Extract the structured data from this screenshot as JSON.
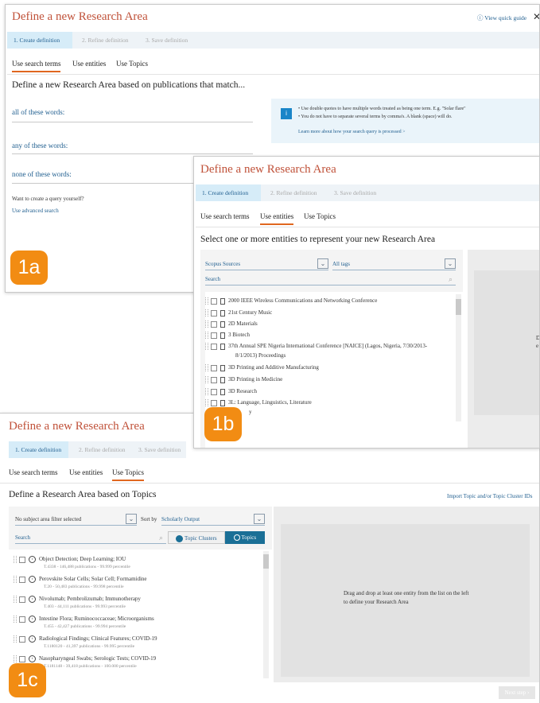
{
  "panel_a": {
    "title": "Define a new Research Area",
    "quick_guide": "View quick guide",
    "steps": [
      "1. Create definition",
      "2. Refine definition",
      "3. Save definition"
    ],
    "tabs": [
      "Use search terms",
      "Use entities",
      "Use Topics"
    ],
    "heading": "Define a new Research Area based on publications that match...",
    "fields": [
      "all of these words:",
      "any of these words:",
      "none of these words:"
    ],
    "info_lines": [
      "Use double quotes to have multiple words treated as being one term. E.g. \"Solar flare\"",
      "You do not have to separate several terms by comma's. A blank (space) will do."
    ],
    "info_link": "Learn more about how your search query is processed >",
    "query_prompt": "Want to create a query yourself?",
    "advanced_link": "Use advanced search",
    "badge": "1a"
  },
  "panel_b": {
    "title": "Define a new Research Area",
    "steps": [
      "1. Create definition",
      "2. Refine definition",
      "3. Save definition"
    ],
    "tabs": [
      "Use search terms",
      "Use entities",
      "Use Topics"
    ],
    "heading": "Select one or more entities to represent your new Research Area",
    "source_select": "Scopus Sources",
    "tag_select": "All tags",
    "search_placeholder": "Search",
    "items": [
      "2000 IEEE Wireless Communications and Networking Conference",
      "21st Century Music",
      "2D Materials",
      "3 Biotech",
      "37th Annual SPE Nigeria International Conference [NAICE] (Lagos, Nigeria, 7/30/2013-",
      "8/1/2013) Proceedings",
      "3D Printing and Additive Manufacturing",
      "3D Printing in Medicine",
      "3D Research",
      "3L: Language, Linguistics, Literature",
      "y"
    ],
    "right_letters": [
      "D",
      "e"
    ],
    "badge": "1b"
  },
  "panel_c": {
    "title": "Define a new Research Area",
    "steps": [
      "1. Create definition",
      "2. Refine definition",
      "3. Save definition"
    ],
    "tabs": [
      "Use search terms",
      "Use entities",
      "Use Topics"
    ],
    "heading": "Define a Research Area based on Topics",
    "import_link": "Import Topic and/or Topic Cluster IDs",
    "subject_filter": "No subject area filter selected",
    "sort_label": "Sort by",
    "sort_value": "Scholarly Output",
    "search_placeholder": "Search",
    "btn_clusters": "Topic Clusters",
    "btn_topics": "Topics",
    "topics": [
      {
        "name": "Object Detection; Deep Learning; IOU",
        "meta": "T.4338 - 146,488 publications - 99.999 percentile"
      },
      {
        "name": "Perovskite Solar Cells; Solar Cell; Formamidine",
        "meta": "T.20 - 50,483 publications - 99.998 percentile"
      },
      {
        "name": "Nivolumab; Pembrolizumab; Immunotherapy",
        "meta": "T.403 - 44,111 publications - 99.993 percentile"
      },
      {
        "name": "Intestine Flora; Ruminococcaceae; Microorganisms",
        "meta": "T.455 - 42,427 publications - 99.994 percentile"
      },
      {
        "name": "Radiological Findings; Clinical Features; COVID-19",
        "meta": "T.1180120 - 41,397 publications - 99.995 percentile"
      },
      {
        "name": "Nasopharyngeal Swabs; Serologic Tests; COVID-19",
        "meta": "T.1181148 - 39,418 publications - 100.000 percentile"
      }
    ],
    "drop_text": "Drag and drop at least one entity from the list on the left to define your Research Area",
    "next_button": "Next step",
    "badge": "1c"
  },
  "colors": {
    "title": "#c0523a",
    "accent_orange": "#f28c13",
    "link_blue": "#1f5e8f",
    "toggle_blue": "#1a6f96"
  }
}
